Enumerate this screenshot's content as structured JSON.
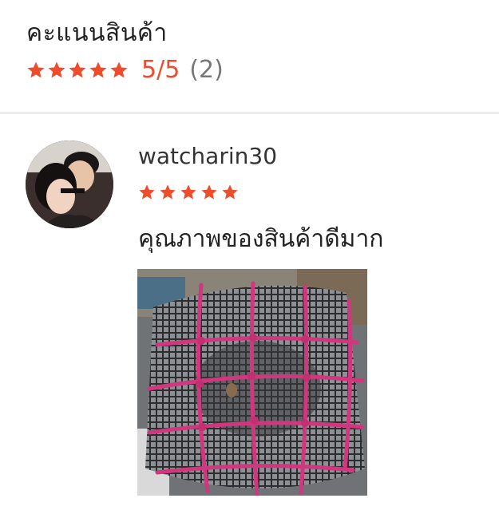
{
  "product_rating": {
    "title": "คะแนนสินค้า",
    "stars": 5,
    "score_text": "5/5",
    "count_text": "(2)",
    "star_color": "#ee4d2d"
  },
  "review": {
    "username": "watcharin30",
    "stars": 5,
    "comment": "คุณภาพของสินค้าดีมาก",
    "avatar_icon": "user-avatar-photo",
    "photo_icon": "product-photo-motorcycle-basket-net"
  }
}
